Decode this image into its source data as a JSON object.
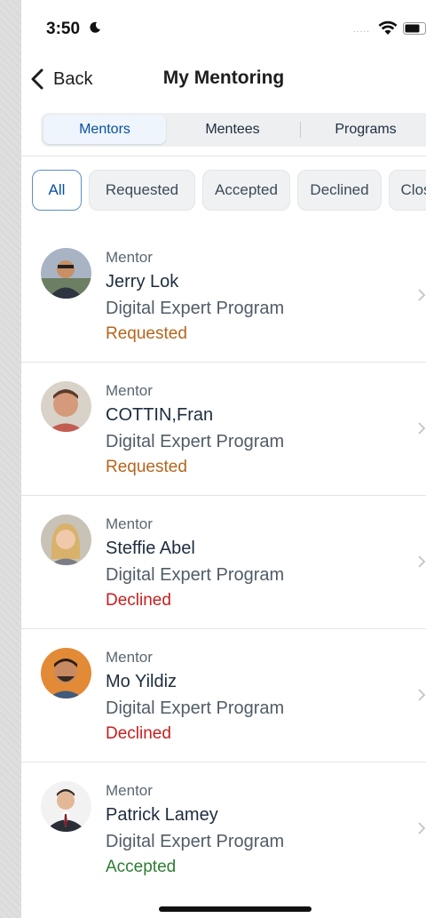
{
  "status_bar": {
    "time": "3:50",
    "signal": "....."
  },
  "nav": {
    "back_label": "Back",
    "title": "My Mentoring"
  },
  "tabs": [
    {
      "label": "Mentors",
      "active": true
    },
    {
      "label": "Mentees",
      "active": false
    },
    {
      "label": "Programs",
      "active": false
    }
  ],
  "filters": [
    {
      "label": "All",
      "active": true
    },
    {
      "label": "Requested",
      "active": false
    },
    {
      "label": "Accepted",
      "active": false
    },
    {
      "label": "Declined",
      "active": false
    },
    {
      "label": "Closed",
      "active": false
    }
  ],
  "mentors": [
    {
      "role": "Mentor",
      "name": "Jerry Lok",
      "program": "Digital Expert Program",
      "status": "Requested",
      "status_color": "#b5651d"
    },
    {
      "role": "Mentor",
      "name": "COTTIN,Fran",
      "program": "Digital Expert Program",
      "status": "Requested",
      "status_color": "#b5651d"
    },
    {
      "role": "Mentor",
      "name": "Steffie Abel",
      "program": "Digital Expert Program",
      "status": "Declined",
      "status_color": "#c81e1e"
    },
    {
      "role": "Mentor",
      "name": "Mo Yildiz",
      "program": "Digital Expert Program",
      "status": "Declined",
      "status_color": "#c81e1e"
    },
    {
      "role": "Mentor",
      "name": "Patrick Lamey",
      "program": "Digital Expert Program",
      "status": "Accepted",
      "status_color": "#2d7d32"
    }
  ],
  "colors": {
    "accent": "#0a4f9e",
    "requested": "#b5651d",
    "declined": "#c81e1e",
    "accepted": "#2d7d32"
  }
}
